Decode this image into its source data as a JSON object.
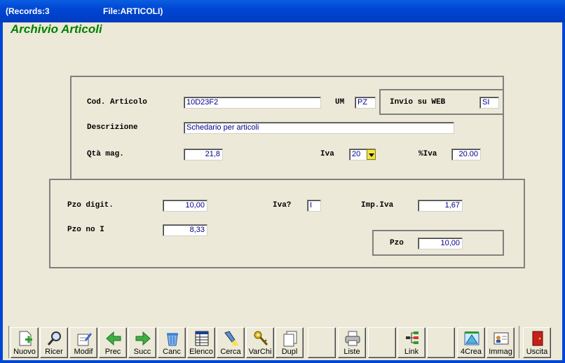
{
  "titlebar": {
    "records": "(Records:3",
    "file": "File:ARTICOLI)"
  },
  "heading": "Archivio Articoli",
  "top_panel": {
    "cod_articolo_label": "Cod. Articolo",
    "cod_articolo_value": "10D23F2",
    "um_label": "UM",
    "um_value": "PZ",
    "descrizione_label": "Descrizione",
    "descrizione_value": "Schedario per articoli",
    "qta_label": "Qtà mag.",
    "qta_value": "21,8",
    "iva_label": "Iva",
    "iva_value": "20",
    "piva_label": "%Iva",
    "piva_value": "20.00"
  },
  "web_panel": {
    "label": "Invio su WEB",
    "value": "SI"
  },
  "bottom_panel": {
    "pzo_digit_label": "Pzo digit.",
    "pzo_digit_value": "10,00",
    "iva_q_label": "Iva?",
    "iva_q_value": "I",
    "imp_iva_label": "Imp.Iva",
    "imp_iva_value": "1,67",
    "pzo_no_i_label": "Pzo no I",
    "pzo_no_i_value": "8,33",
    "pzo_label": "Pzo",
    "pzo_value": "10,00"
  },
  "toolbar": {
    "buttons": [
      {
        "label": "Nuovo",
        "icon": "new-document-icon"
      },
      {
        "label": "Ricer",
        "icon": "magnifier-icon"
      },
      {
        "label": "Modif",
        "icon": "edit-icon"
      },
      {
        "label": "Prec",
        "icon": "arrow-left-icon"
      },
      {
        "label": "Succ",
        "icon": "arrow-right-icon"
      },
      {
        "label": "Canc",
        "icon": "trash-icon"
      },
      {
        "label": "Elenco",
        "icon": "list-icon"
      },
      {
        "label": "Cerca",
        "icon": "flashlight-icon"
      },
      {
        "label": "VarChi",
        "icon": "keys-icon"
      },
      {
        "label": "Dupl",
        "icon": "duplicate-icon"
      },
      {
        "label": "Liste",
        "icon": "printer-icon"
      },
      {
        "label": "Link",
        "icon": "tree-icon"
      },
      {
        "label": "4Crea",
        "icon": "create-icon"
      },
      {
        "label": "Immag",
        "icon": "id-card-icon"
      },
      {
        "label": "Uscita",
        "icon": "exit-door-icon"
      }
    ]
  },
  "colors": {
    "heading": "#008000",
    "field_text": "#00008B",
    "titlebar": "#0046D5",
    "window_bg": "#ECE9D8"
  }
}
